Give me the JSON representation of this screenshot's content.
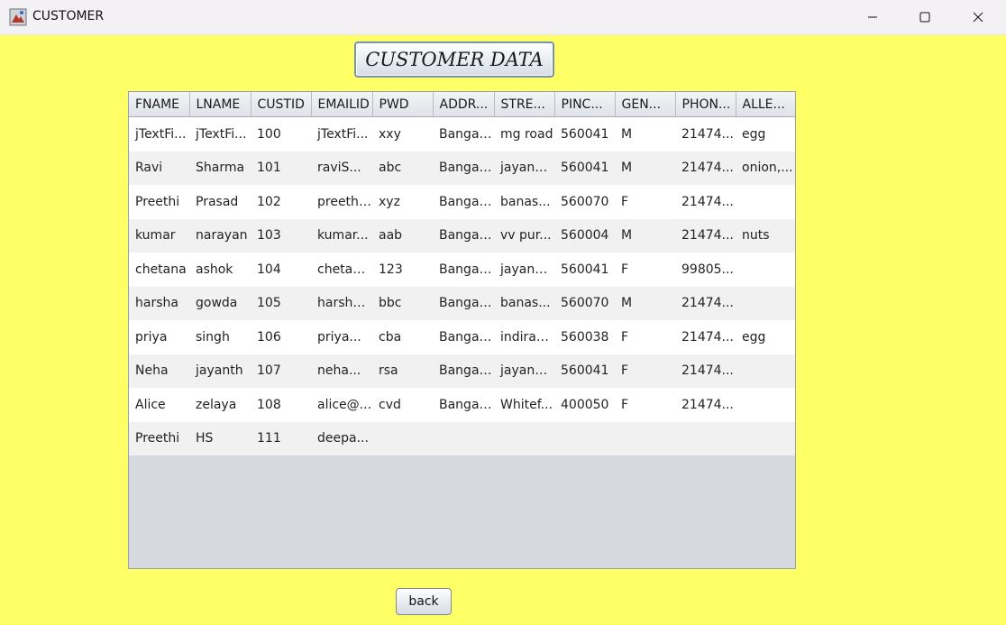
{
  "window": {
    "title": "CUSTOMER",
    "controls": {
      "minimize_icon": "minimize-icon",
      "maximize_icon": "maximize-icon",
      "close_icon": "close-icon"
    }
  },
  "heading": "CUSTOMER DATA",
  "table": {
    "columns": [
      "FNAME",
      "LNAME",
      "CUSTID",
      "EMAILID",
      "PWD",
      "ADDRESS",
      "STREET",
      "PINCODE",
      "GENDER",
      "PHONE",
      "ALLERGY"
    ],
    "columns_display": [
      "FNAME",
      "LNAME",
      "CUSTID",
      "EMAILID",
      "PWD",
      "ADDR...",
      "STRE...",
      "PINC...",
      "GEN...",
      "PHON...",
      "ALLE..."
    ],
    "rows": [
      [
        "jTextFi...",
        "jTextFi...",
        "100",
        "jTextFi...",
        "xxy",
        "Bangal...",
        "mg road",
        "560041",
        "M",
        "21474...",
        "egg"
      ],
      [
        "Ravi",
        "Sharma",
        "101",
        "raviS...",
        "abc",
        "Bangal...",
        "jayana...",
        "560041",
        "M",
        "21474...",
        "onion,..."
      ],
      [
        "Preethi",
        "Prasad",
        "102",
        "preethi...",
        "xyz",
        "Bangal...",
        "banas...",
        "560070",
        "F",
        "21474...",
        ""
      ],
      [
        "kumar",
        "narayan",
        "103",
        "kumar...",
        "aab",
        "Bangal...",
        "vv pur...",
        "560004",
        "M",
        "21474...",
        "nuts"
      ],
      [
        "chetana",
        "ashok",
        "104",
        "chetan...",
        "123",
        "Bangal...",
        "jayana...",
        "560041",
        "F",
        "99805...",
        ""
      ],
      [
        "harsha",
        "gowda",
        "105",
        "harsha...",
        "bbc",
        "Bangal...",
        " banas...",
        "560070",
        "M",
        "21474...",
        ""
      ],
      [
        "priya",
        "singh",
        "106",
        "priya...",
        "cba",
        "Bangal...",
        "indiran...",
        "560038",
        "F",
        "21474...",
        "egg"
      ],
      [
        "Neha",
        "jayanth",
        "107",
        "neha...",
        "rsa",
        "Bangal...",
        "jayana...",
        "560041",
        "F",
        "21474...",
        ""
      ],
      [
        "Alice",
        "zelaya",
        "108",
        "alice@...",
        "cvd",
        "Bangal...",
        "Whitef...",
        "400050",
        "F",
        "21474...",
        ""
      ],
      [
        "Preethi",
        "HS",
        "111",
        "deepa...",
        "",
        "",
        "",
        "",
        "",
        "",
        ""
      ]
    ]
  },
  "back_label": "back"
}
